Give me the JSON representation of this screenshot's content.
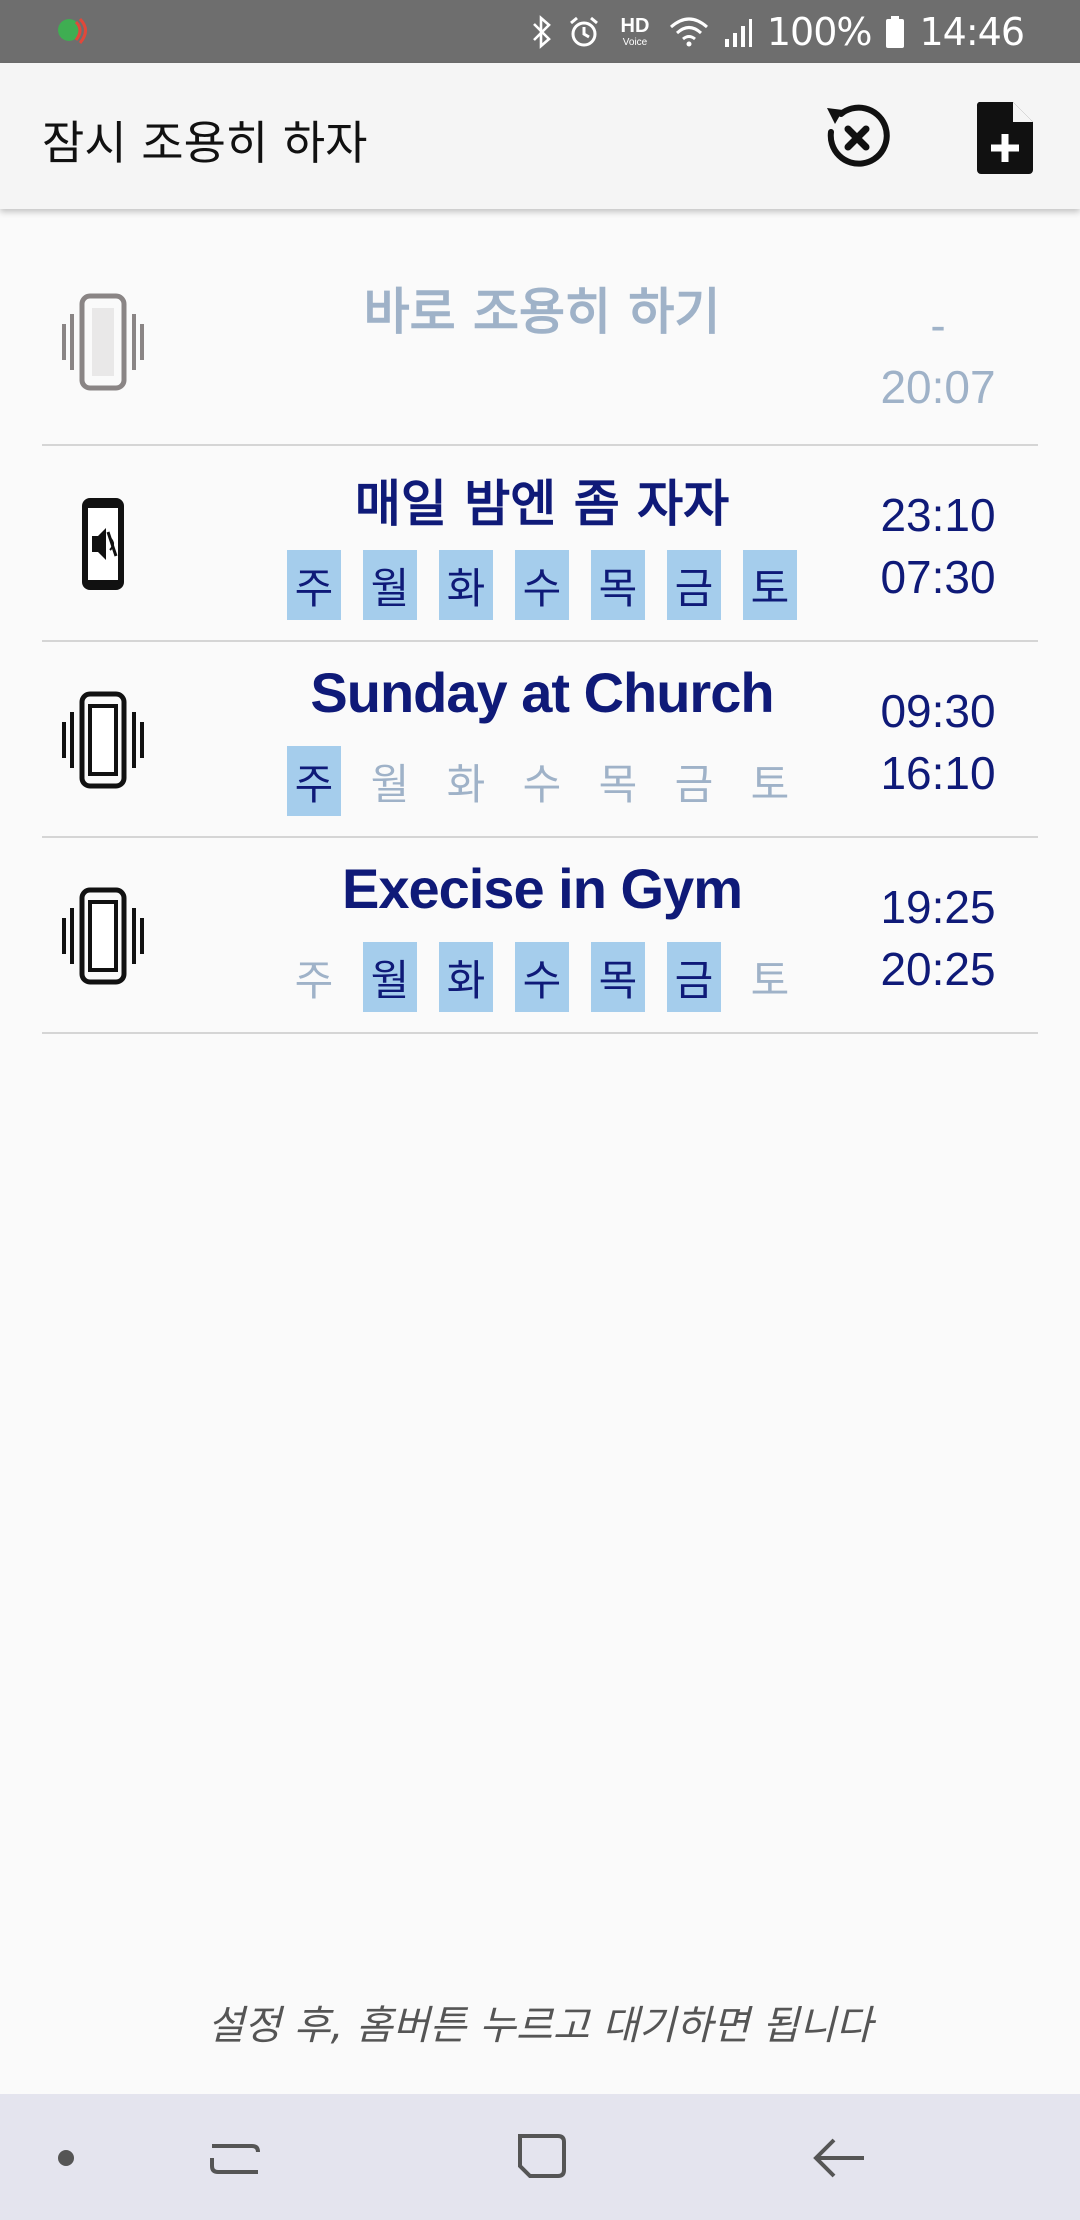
{
  "status_bar": {
    "left_icon": "app-notification-icon",
    "icons": [
      "bluetooth-icon",
      "alarm-icon",
      "hd-voice-icon",
      "wifi-icon",
      "signal-icon",
      "battery-icon"
    ],
    "hd_label": "HD",
    "voice_label": "Voice",
    "battery_percent": "100%",
    "time": "14:46"
  },
  "appbar": {
    "title": "잠시 조용히 하자",
    "reset_icon": "reset-cancel-icon",
    "add_icon": "add-file-icon"
  },
  "items": [
    {
      "title": "바로 조용히 하기",
      "icon": "vibrate-phone-icon",
      "enabled": false,
      "start": "-",
      "end": "20:07",
      "days": []
    },
    {
      "title": "매일 밤엔 좀 자자",
      "icon": "muted-phone-icon",
      "enabled": true,
      "start": "23:10",
      "end": "07:30",
      "days": [
        {
          "label": "주",
          "on": true
        },
        {
          "label": "월",
          "on": true
        },
        {
          "label": "화",
          "on": true
        },
        {
          "label": "수",
          "on": true
        },
        {
          "label": "목",
          "on": true
        },
        {
          "label": "금",
          "on": true
        },
        {
          "label": "토",
          "on": true
        }
      ]
    },
    {
      "title": "Sunday at Church",
      "icon": "vibrate-phone-icon",
      "enabled": true,
      "start": "09:30",
      "end": "16:10",
      "days": [
        {
          "label": "주",
          "on": true
        },
        {
          "label": "월",
          "on": false
        },
        {
          "label": "화",
          "on": false
        },
        {
          "label": "수",
          "on": false
        },
        {
          "label": "목",
          "on": false
        },
        {
          "label": "금",
          "on": false
        },
        {
          "label": "토",
          "on": false
        }
      ]
    },
    {
      "title": "Execise in Gym",
      "icon": "vibrate-phone-icon",
      "enabled": true,
      "start": "19:25",
      "end": "20:25",
      "days": [
        {
          "label": "주",
          "on": false
        },
        {
          "label": "월",
          "on": true
        },
        {
          "label": "화",
          "on": true
        },
        {
          "label": "수",
          "on": true
        },
        {
          "label": "목",
          "on": true
        },
        {
          "label": "금",
          "on": true
        },
        {
          "label": "토",
          "on": false
        }
      ]
    }
  ],
  "footer_hint": "설정 후, 홈버튼 누르고 대기하면 됩니다",
  "nav_bar": {
    "icons": [
      "dot-icon",
      "recent-apps-icon",
      "home-icon",
      "back-icon"
    ]
  },
  "colors": {
    "primary_text": "#0f1a78",
    "disabled_text": "#9fb2c8",
    "day_highlight": "#a5cdec",
    "status_bar": "#6e6e6e",
    "nav_bar": "#e4e4ee"
  }
}
